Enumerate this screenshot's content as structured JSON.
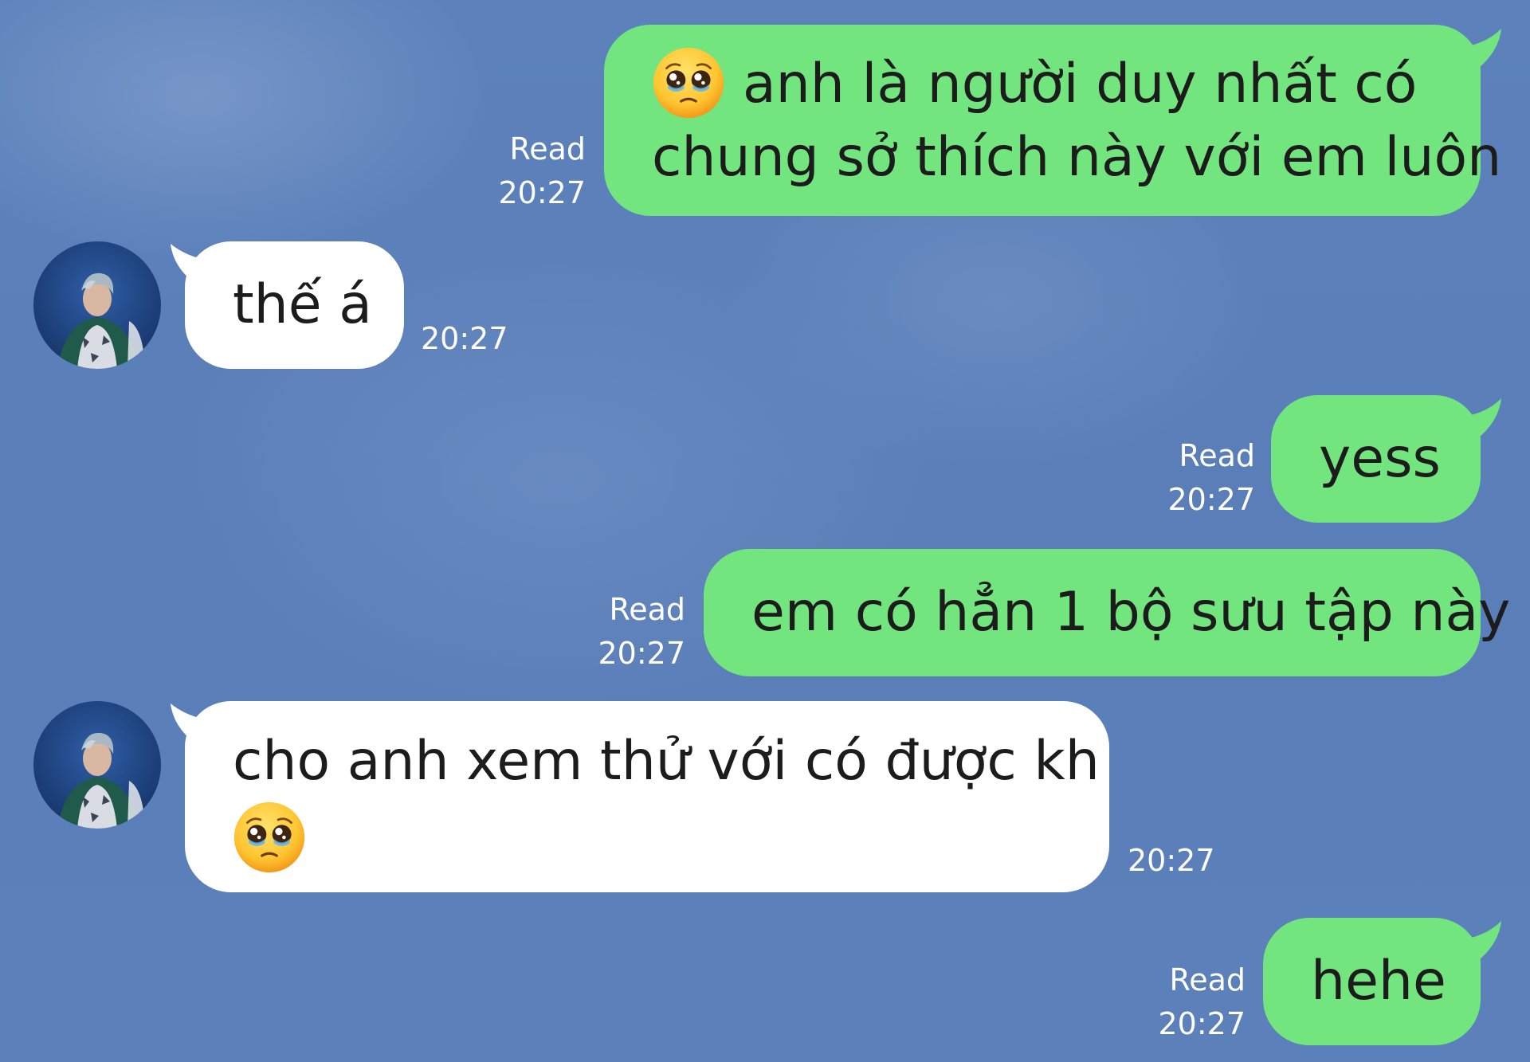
{
  "messages": [
    {
      "direction": "out",
      "emoji": "pleading-face",
      "lines": [
        "anh là người duy nhất có",
        "chung sở thích này với em luôn"
      ],
      "status": "Read",
      "time": "20:27"
    },
    {
      "direction": "in",
      "lines": [
        "thế á"
      ],
      "time": "20:27"
    },
    {
      "direction": "out",
      "lines": [
        "yess"
      ],
      "status": "Read",
      "time": "20:27"
    },
    {
      "direction": "out",
      "lines": [
        "em có hẳn 1 bộ sưu tập này"
      ],
      "status": "Read",
      "time": "20:27"
    },
    {
      "direction": "in",
      "emoji": "pleading-face",
      "lines": [
        "cho anh xem thử với có được kh"
      ],
      "time": "20:27"
    },
    {
      "direction": "out",
      "lines": [
        "hehe"
      ],
      "status": "Read",
      "time": "20:27"
    }
  ],
  "colors": {
    "background": "#5b7fb8",
    "outgoing_bubble": "#72e57f",
    "incoming_bubble": "#ffffff",
    "meta_text": "#ffffff"
  }
}
